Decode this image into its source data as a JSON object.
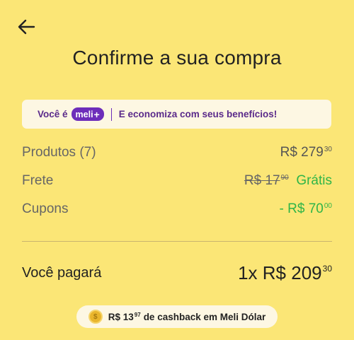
{
  "header": {
    "title": "Confirme a sua compra"
  },
  "banner": {
    "prefix": "Você é",
    "logo_text": "meli",
    "logo_plus": "+",
    "message": "E economiza com seus benefícios!"
  },
  "summary": {
    "products": {
      "label": "Produtos (7)",
      "currency": "R$",
      "integer": "279",
      "cents": "30"
    },
    "shipping": {
      "label": "Frete",
      "old_currency": "R$",
      "old_integer": "17",
      "old_cents": "90",
      "value": "Grátis"
    },
    "coupons": {
      "label": "Cupons",
      "prefix": "- R$",
      "integer": "70",
      "cents": "00"
    }
  },
  "total": {
    "label": "Você pagará",
    "installments": "1x R$",
    "integer": "209",
    "cents": "30"
  },
  "cashback": {
    "currency": "R$",
    "integer": "13",
    "cents": "97",
    "text": "de cashback em Meli Dólar"
  },
  "colors": {
    "background": "#fbe676",
    "accent_purple": "#6d2dba",
    "green": "#2fb548"
  },
  "icons": {
    "back": "arrow-left-icon",
    "coin": "coin-icon"
  }
}
